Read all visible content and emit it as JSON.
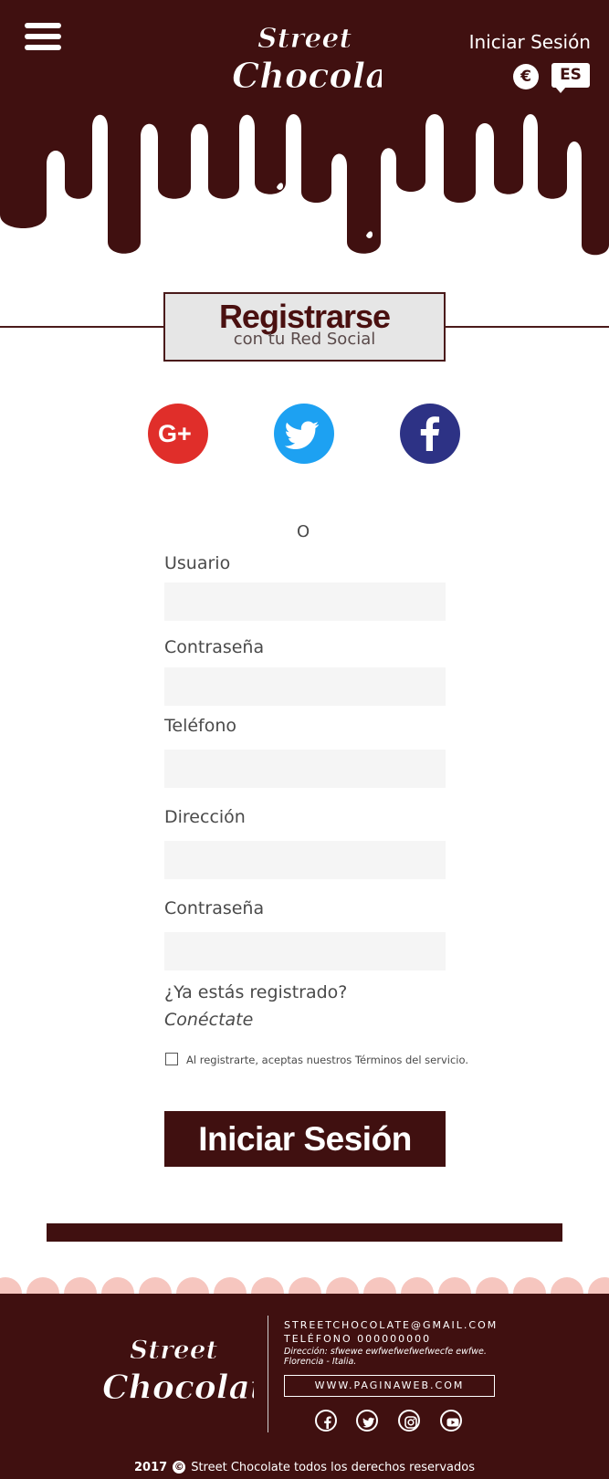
{
  "header": {
    "login_label": "Iniciar Sesión",
    "currency_symbol": "€",
    "language": "ES",
    "brand_color": "#401010"
  },
  "signup": {
    "title": "Registrarse",
    "subtitle": "con tu Red Social",
    "or_label": "O",
    "social": [
      {
        "name": "google-plus",
        "color": "#e02e2a"
      },
      {
        "name": "twitter",
        "color": "#1da1f2"
      },
      {
        "name": "facebook",
        "color": "#2d3285"
      }
    ],
    "fields": [
      {
        "label": "Usuario",
        "value": ""
      },
      {
        "label": "Contraseña",
        "value": ""
      },
      {
        "label": "Teléfono",
        "value": ""
      },
      {
        "label": "Dirección",
        "value": ""
      },
      {
        "label": "Contraseña",
        "value": ""
      }
    ],
    "already_registered": "¿Ya estás registrado?",
    "connect_label": "Conéctate",
    "terms_text": "Al registrarte, aceptas nuestros Términos del servicio.",
    "terms_checked": false,
    "submit_label": "Iniciar Sesión"
  },
  "footer": {
    "email": "STREETCHOCOLATE@GMAIL.COM",
    "phone": "TELÉFONO 000000000",
    "address": "Dirección: sfwewe ewfwefwefwefwecfe ewfwe. Florencia - Italia.",
    "website": "WWW.PAGINAWEB.COM",
    "social_icons": [
      "facebook-icon",
      "twitter-icon",
      "instagram-icon",
      "youtube-icon"
    ],
    "copyright_year": "2017",
    "copyright_text": "Street Chocolate todos los derechos reservados",
    "scallop_color": "#f6c6bf"
  }
}
